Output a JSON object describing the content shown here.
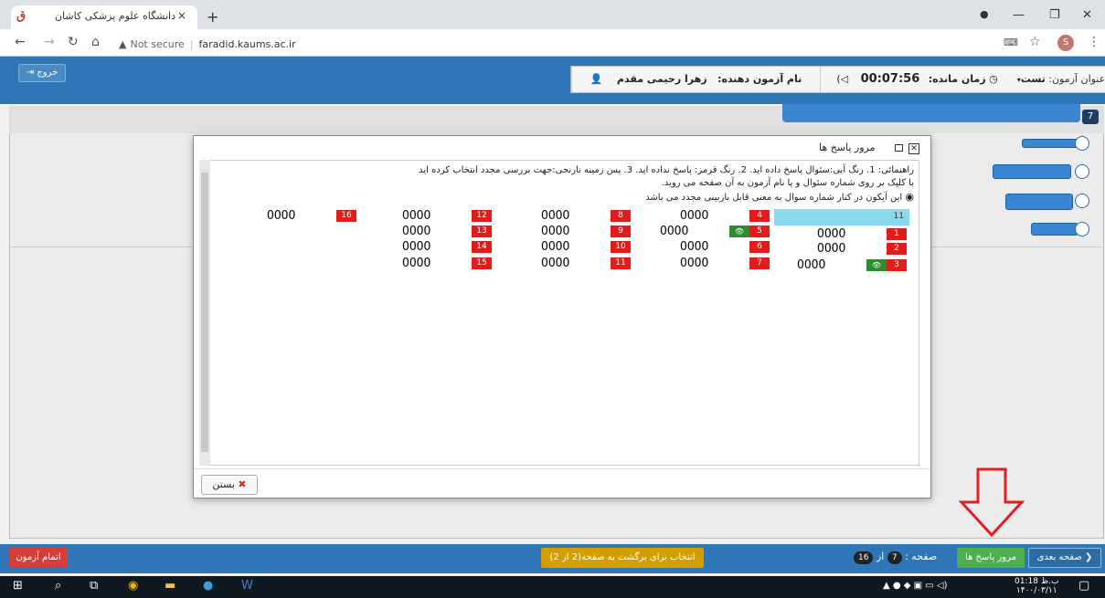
{
  "browser": {
    "tab_title": "دانشگاه علوم پزشکی کاشان",
    "tab_logo": "ق",
    "close_tab": "×",
    "new_tab": "+",
    "not_secure": "Not secure",
    "url": "faradid.kaums.ac.ir",
    "profile_initial": "S"
  },
  "header": {
    "exit_label": "خروج",
    "exam_title_label": "عنوان آزمون:",
    "exam_title_value": "تست",
    "time_left_label": "زمان مانده:",
    "time_left_value": "00:07:56",
    "examinee_label": "نام آزمون دهنده:",
    "examinee_value": "زهرا رحیمی مقدم"
  },
  "question": {
    "number": "7"
  },
  "modal": {
    "title": "مرور پاسخ ها",
    "guide_line1": "راهنمائی: 1. رنگ آبی:سئوال پاسخ داده اید. 2. رنگ قرمز: پاسخ نداده اید. 3. پس زمینه نارنجی:جهت بررسی مجدد انتخاب کرده اید",
    "guide_line2": "با کلیک بر روی شماره سئوال و یا نام آزمون به آن صفحه می روید.",
    "guide_line3": "این آیکون در کنار شماره سوال به معنی قابل بازبینی مجدد می باشد",
    "close_label": "بستن",
    "highlight_label": "11",
    "options_text": "OOOO",
    "eye_icon_text": "👁"
  },
  "answers": [
    {
      "num": "1",
      "review": false
    },
    {
      "num": "2",
      "review": false
    },
    {
      "num": "3",
      "review": true
    },
    {
      "num": "4",
      "review": false
    },
    {
      "num": "5",
      "review": true
    },
    {
      "num": "6",
      "review": false
    },
    {
      "num": "7",
      "review": false
    },
    {
      "num": "8",
      "review": false
    },
    {
      "num": "9",
      "review": false
    },
    {
      "num": "10",
      "review": false
    },
    {
      "num": "11",
      "review": false
    },
    {
      "num": "12",
      "review": false
    },
    {
      "num": "13",
      "review": false
    },
    {
      "num": "14",
      "review": false
    },
    {
      "num": "15",
      "review": false
    },
    {
      "num": "16",
      "review": false
    }
  ],
  "footer": {
    "finish_label": "اتمام آزمون",
    "back_label": "انتخاب برای برگشت به صفحه(2 از 2)",
    "page_label": "صفحه :",
    "page_current": "7",
    "page_of": "از",
    "page_total": "16",
    "review_label": "مرور پاسخ ها",
    "next_label": "صفحه بعدی"
  },
  "taskbar": {
    "time": "01:18 ب.ظ",
    "date": "۱۴۰۰/۰۳/۱۱"
  },
  "colors": {
    "header_blue": "#2e76b5",
    "unanswered_red": "#e21b1b",
    "review_green": "#2e8b2e",
    "highlight_cyan": "#8ad8ec",
    "arrow_red": "#e02020"
  }
}
